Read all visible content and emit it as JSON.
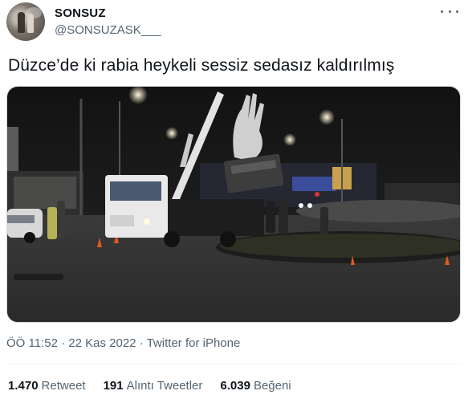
{
  "user": {
    "display_name": "SONSUZ",
    "handle": "@SONSUZASK___"
  },
  "tweet": {
    "text": "Düzce’de ki rabia heykeli sessiz sedasız kaldırılmış",
    "time": "ÖÖ 11:52",
    "separator": "·",
    "date": "22 Kas 2022",
    "source": "Twitter for iPhone"
  },
  "stats": [
    {
      "count": "1.470",
      "label": "Retweet"
    },
    {
      "count": "191",
      "label": "Alıntı Tweetler"
    },
    {
      "count": "6.039",
      "label": "Beğeni"
    }
  ],
  "icons": {
    "more": "more-horizontal-icon"
  }
}
